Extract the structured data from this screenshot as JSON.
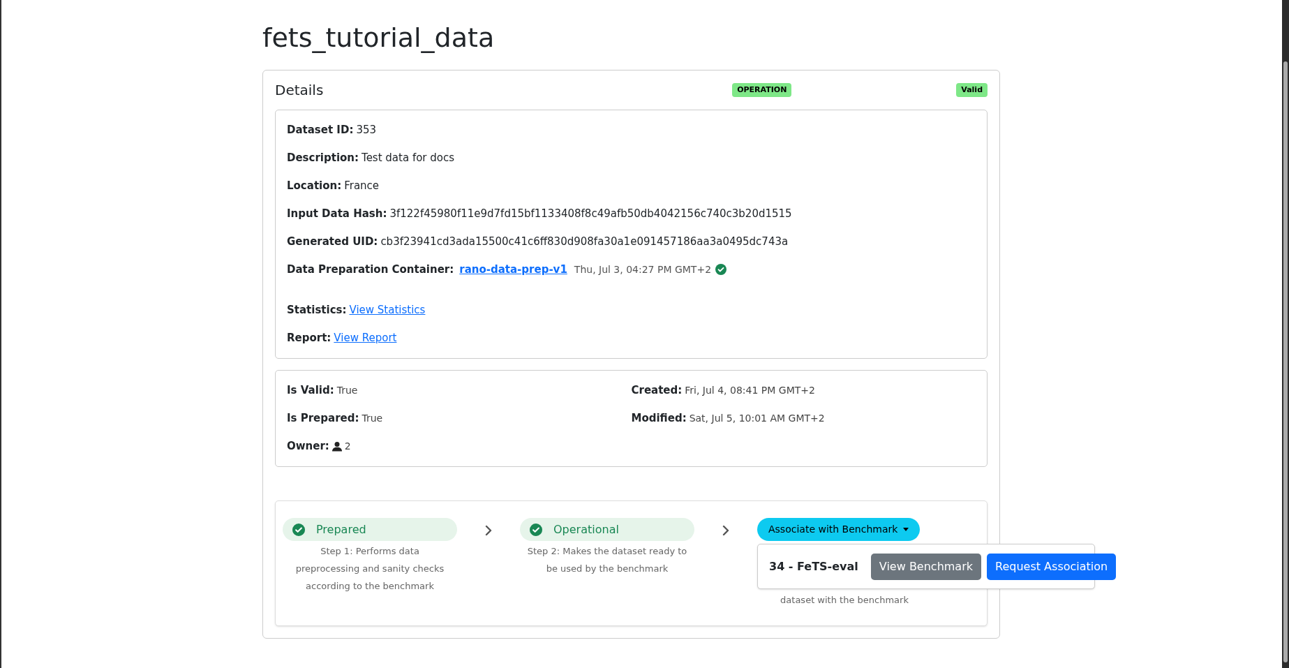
{
  "page_title": "fets_tutorial_data",
  "details": {
    "title": "Details",
    "badges": [
      "OPERATION",
      "Valid"
    ]
  },
  "info": [
    {
      "kind": "text",
      "label": "Dataset ID:",
      "value": "353"
    },
    {
      "kind": "text",
      "label": "Description:",
      "value": "Test data for docs"
    },
    {
      "kind": "text",
      "label": "Location:",
      "value": "France"
    },
    {
      "kind": "text",
      "label": "Input Data Hash:",
      "value": "3f122f45980f11e9d7fd15bf1133408f8c49afb50db4042156c740c3b20d1515"
    },
    {
      "kind": "text",
      "label": "Generated UID:",
      "value": "cb3f23941cd3ada15500c41c6ff830d908fa30a1e091457186aa3a0495dc743a"
    },
    {
      "kind": "container",
      "label": "Data Preparation Container:",
      "value": "rano-data-prep-v1",
      "date": "Thu, Jul 3, 04:27 PM GMT+2",
      "verified": true
    },
    {
      "kind": "link",
      "label": "Statistics:",
      "value": "View Statistics"
    },
    {
      "kind": "link",
      "label": "Report:",
      "value": "View Report"
    }
  ],
  "meta_left": [
    {
      "kind": "text",
      "label": "Is Valid:",
      "value": "True"
    },
    {
      "kind": "text",
      "label": "Is Prepared:",
      "value": "True"
    },
    {
      "kind": "owner",
      "label": "Owner:",
      "value": "2"
    }
  ],
  "meta_right": [
    {
      "label": "Created:",
      "value": "Fri, Jul 4, 08:41 PM GMT+2"
    },
    {
      "label": "Modified:",
      "value": "Sat, Jul 5, 10:01 AM GMT+2"
    }
  ],
  "steps": [
    {
      "kind": "status",
      "label": "Prepared",
      "done": true,
      "description": "Step 1: Performs data preprocessing and sanity checks according to the benchmark"
    },
    {
      "kind": "status",
      "label": "Operational",
      "done": true,
      "description": "Step 2: Makes the dataset ready to be used by the benchmark"
    },
    {
      "kind": "dropdown",
      "label": "Associate with Benchmark",
      "expanded": true,
      "description": "dataset with the benchmark",
      "menu": {
        "benchmark": "34 - FeTS-eval",
        "buttons": [
          "View Benchmark",
          "Request Association"
        ]
      }
    }
  ]
}
